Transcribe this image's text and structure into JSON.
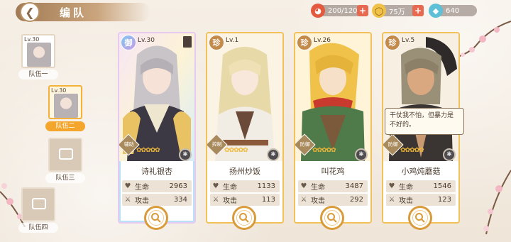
{
  "header": {
    "title": "编队"
  },
  "resources": [
    {
      "name": "stamina",
      "icon": "bowl-icon",
      "value": "200/120"
    },
    {
      "name": "gold",
      "icon": "coin-icon",
      "value": "75万"
    },
    {
      "name": "gem",
      "icon": "gem-icon",
      "value": "640"
    }
  ],
  "teams": [
    {
      "label": "队伍一",
      "level": "Lv.30",
      "has_portrait": true,
      "selected": false
    },
    {
      "label": "队伍二",
      "level": "Lv.30",
      "has_portrait": true,
      "selected": true
    },
    {
      "label": "队伍三",
      "level": "",
      "has_portrait": false,
      "selected": false
    },
    {
      "label": "队伍四",
      "level": "",
      "has_portrait": false,
      "selected": false
    }
  ],
  "cards": [
    {
      "rarity": "御",
      "level": "Lv.30",
      "role": "辅助",
      "name": "诗礼银杏",
      "hp_label": "生命",
      "hp": "2963",
      "atk_label": "攻击",
      "atk": "334",
      "style": "rainbow"
    },
    {
      "rarity": "珍",
      "level": "Lv.1",
      "role": "控制",
      "name": "扬州炒饭",
      "hp_label": "生命",
      "hp": "1133",
      "atk_label": "攻击",
      "atk": "113",
      "style": "gold"
    },
    {
      "rarity": "珍",
      "level": "Lv.26",
      "role": "防御",
      "name": "叫花鸡",
      "hp_label": "生命",
      "hp": "3487",
      "atk_label": "攻击",
      "atk": "292",
      "style": "gold"
    },
    {
      "rarity": "珍",
      "level": "Lv.5",
      "role": "防御",
      "name": "小鸡炖蘑菇",
      "hp_label": "生命",
      "hp": "1546",
      "atk_label": "攻击",
      "atk": "123",
      "style": "gold"
    }
  ],
  "speech_bubble": "干仗我不怕，但暴力是不好的。",
  "colors": {
    "accent_gold": "#f3c15a",
    "selected_orange": "#f4a52c",
    "plus_red": "#e7694f"
  }
}
